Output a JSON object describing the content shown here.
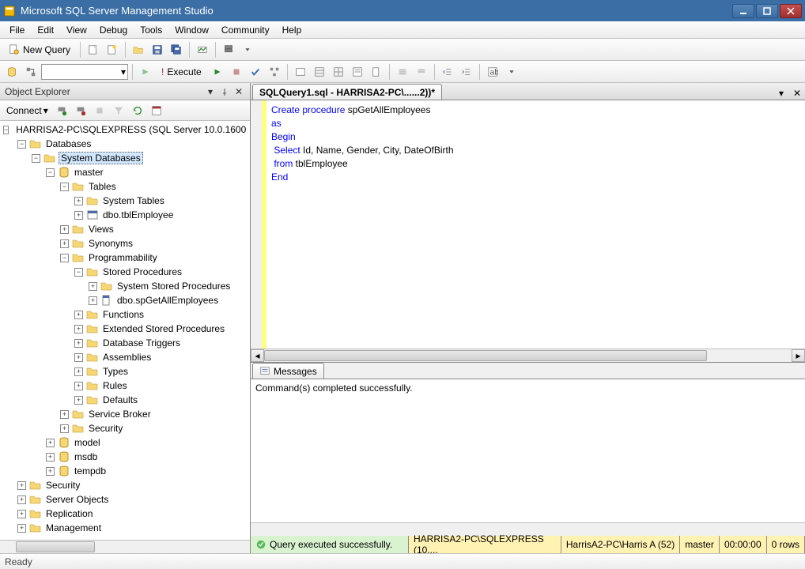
{
  "title": "Microsoft SQL Server Management Studio",
  "menu": [
    "File",
    "Edit",
    "View",
    "Debug",
    "Tools",
    "Window",
    "Community",
    "Help"
  ],
  "toolbar1": {
    "new_query": "New Query"
  },
  "toolbar2": {
    "execute": "Execute"
  },
  "object_explorer": {
    "title": "Object Explorer",
    "connect": "Connect",
    "server": "HARRISA2-PC\\SQLEXPRESS (SQL Server 10.0.1600",
    "selected_node": "System Databases",
    "nodes_databases": "Databases",
    "nodes_system_databases": "System Databases",
    "nodes_master": "master",
    "nodes_tables": "Tables",
    "nodes_system_tables": "System Tables",
    "nodes_dbo_tblemployee": "dbo.tblEmployee",
    "nodes_views": "Views",
    "nodes_synonyms": "Synonyms",
    "nodes_programmability": "Programmability",
    "nodes_stored_procedures": "Stored Procedures",
    "nodes_system_stored_procedures": "System Stored Procedures",
    "nodes_dbo_spgetallemployees": "dbo.spGetAllEmployees",
    "nodes_functions": "Functions",
    "nodes_ext_stored_procedures": "Extended Stored Procedures",
    "nodes_database_triggers": "Database Triggers",
    "nodes_assemblies": "Assemblies",
    "nodes_types": "Types",
    "nodes_rules": "Rules",
    "nodes_defaults": "Defaults",
    "nodes_service_broker": "Service Broker",
    "nodes_security_inner": "Security",
    "nodes_model": "model",
    "nodes_msdb": "msdb",
    "nodes_tempdb": "tempdb",
    "nodes_security": "Security",
    "nodes_server_objects": "Server Objects",
    "nodes_replication": "Replication",
    "nodes_management": "Management"
  },
  "editor_tab": "SQLQuery1.sql - HARRISA2-PC\\......2))*",
  "sql": {
    "l1a": "Create procedure",
    "l1b": " spGetAllEmployees",
    "l2": "as",
    "l3": "Begin",
    "l4a": " ",
    "l4b": "Select",
    "l4c": " Id, Name, Gender, City, DateOfBirth",
    "l5a": " ",
    "l5b": "from",
    "l5c": " tblEmployee",
    "l6": "End"
  },
  "messages_tab": "Messages",
  "messages_text": "Command(s) completed successfully.",
  "editor_status": {
    "exec": "Query executed successfully.",
    "server": "HARRISA2-PC\\SQLEXPRESS (10....",
    "user": "HarrisA2-PC\\Harris A (52)",
    "db": "master",
    "time": "00:00:00",
    "rows": "0 rows"
  },
  "status": "Ready"
}
